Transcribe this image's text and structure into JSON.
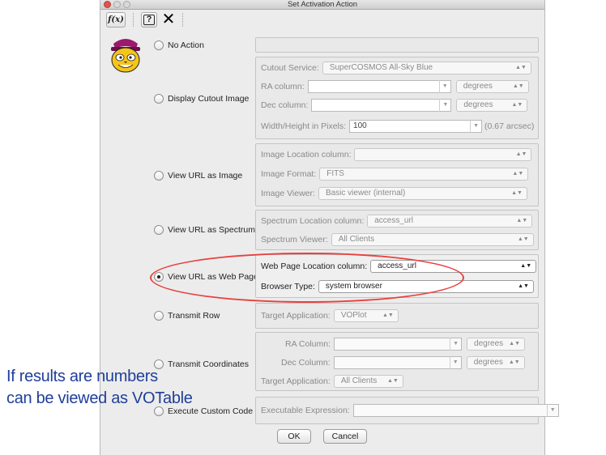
{
  "window": {
    "title": "Set Activation Action"
  },
  "toolbar": {
    "fx_label": "f(x)",
    "help_label": "?",
    "close_label": "✕"
  },
  "options": [
    {
      "label": "No Action",
      "selected": false
    },
    {
      "label": "Display Cutout Image",
      "selected": false
    },
    {
      "label": "View URL as Image",
      "selected": false
    },
    {
      "label": "View URL as Spectrum",
      "selected": false
    },
    {
      "label": "View URL as Web Page",
      "selected": true
    },
    {
      "label": "Transmit Row",
      "selected": false
    },
    {
      "label": "Transmit Coordinates",
      "selected": false
    },
    {
      "label": "Execute Custom Code",
      "selected": false
    }
  ],
  "cutout": {
    "service_label": "Cutout Service:",
    "service_value": "SuperCOSMOS All-Sky Blue",
    "ra_label": "RA column:",
    "ra_value": "",
    "ra_unit": "degrees",
    "dec_label": "Dec column:",
    "dec_value": "",
    "dec_unit": "degrees",
    "size_label": "Width/Height in Pixels:",
    "size_value": "100",
    "size_note": "(0.67 arcsec)"
  },
  "image": {
    "location_label": "Image Location column:",
    "location_value": "",
    "format_label": "Image Format:",
    "format_value": "FITS",
    "viewer_label": "Image Viewer:",
    "viewer_value": "Basic viewer (internal)"
  },
  "spectrum": {
    "location_label": "Spectrum Location column:",
    "location_value": "access_url",
    "viewer_label": "Spectrum Viewer:",
    "viewer_value": "All Clients"
  },
  "webpage": {
    "location_label": "Web Page Location column:",
    "location_value": "access_url",
    "browser_label": "Browser Type:",
    "browser_value": "system browser"
  },
  "transmit_row": {
    "target_label": "Target Application:",
    "target_value": "VOPlot"
  },
  "transmit_coords": {
    "ra_label": "RA Column:",
    "ra_value": "",
    "ra_unit": "degrees",
    "dec_label": "Dec Column:",
    "dec_value": "",
    "dec_unit": "degrees",
    "target_label": "Target Application:",
    "target_value": "All Clients"
  },
  "custom_code": {
    "expr_label": "Executable Expression:",
    "expr_value": ""
  },
  "buttons": {
    "ok": "OK",
    "cancel": "Cancel"
  },
  "annotation": {
    "line1": "If results are numbers",
    "line2": "can be viewed as  VOTable"
  },
  "colors": {
    "highlight_ellipse": "#e8413f",
    "annotation_text": "#1f3f9a",
    "window_bg": "#ececec"
  }
}
